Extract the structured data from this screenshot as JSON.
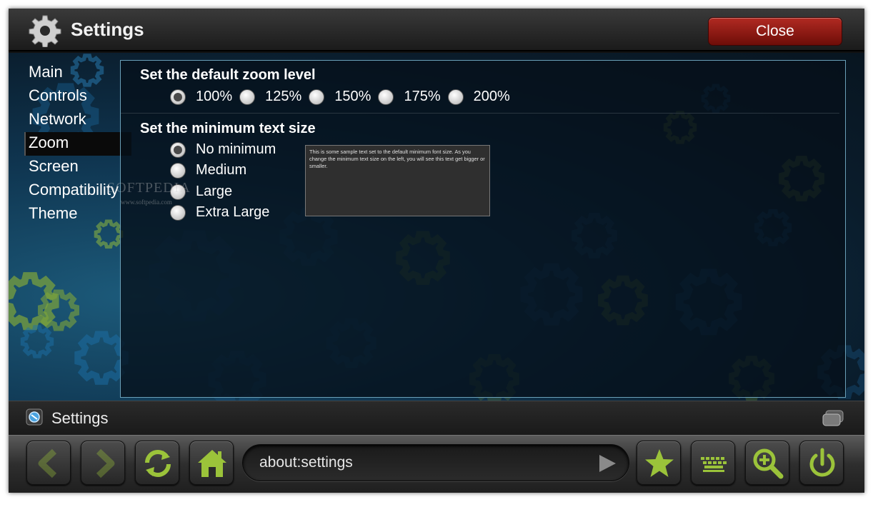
{
  "window": {
    "title": "Settings",
    "close_label": "Close"
  },
  "sidebar": {
    "items": [
      {
        "label": "Main"
      },
      {
        "label": "Controls"
      },
      {
        "label": "Network"
      },
      {
        "label": "Zoom",
        "active": true
      },
      {
        "label": "Screen"
      },
      {
        "label": "Compatibility"
      },
      {
        "label": "Theme"
      }
    ]
  },
  "zoom_section": {
    "title": "Set the default zoom level",
    "options": [
      "100%",
      "125%",
      "150%",
      "175%",
      "200%"
    ],
    "selected": "100%"
  },
  "text_size_section": {
    "title": "Set the minimum text size",
    "options": [
      "No minimum",
      "Medium",
      "Large",
      "Extra Large"
    ],
    "selected": "No minimum",
    "sample_text": "This is some sample text set to the default minimum font size. As you change the minimum text size on the left, you will see this text get bigger or smaller."
  },
  "watermark": {
    "brand": "SOFTPEDIA",
    "url": "www.softpedia.com"
  },
  "status": {
    "tab_title": "Settings"
  },
  "toolbar": {
    "url": "about:settings",
    "buttons": [
      "back-icon",
      "forward-icon",
      "reload-icon",
      "home-icon",
      "star-icon",
      "keyboard-icon",
      "zoom-in-icon",
      "power-icon"
    ]
  },
  "colors": {
    "accent_green": "#9bc33a",
    "close_red": "#a01e17",
    "panel_border": "#6aa0b8"
  }
}
